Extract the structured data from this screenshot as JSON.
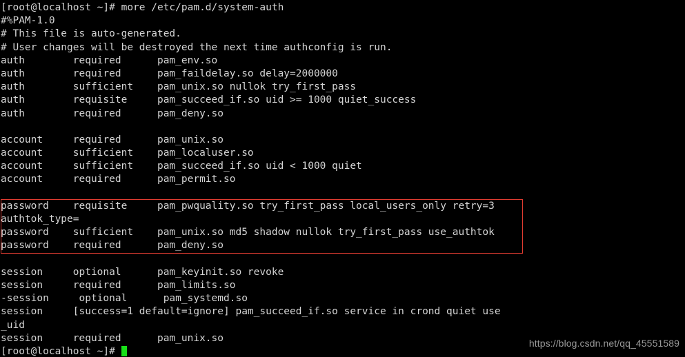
{
  "terminal": {
    "prompt": "[root@localhost ~]#",
    "command": "more /etc/pam.d/system-auth",
    "background_color": "#000000",
    "text_color": "#d4d4d4",
    "cursor_color": "#18e018",
    "highlight_color": "#e03c31",
    "lines": [
      "[root@localhost ~]# more /etc/pam.d/system-auth",
      "#%PAM-1.0",
      "# This file is auto-generated.",
      "# User changes will be destroyed the next time authconfig is run.",
      "auth        required      pam_env.so",
      "auth        required      pam_faildelay.so delay=2000000",
      "auth        sufficient    pam_unix.so nullok try_first_pass",
      "auth        requisite     pam_succeed_if.so uid >= 1000 quiet_success",
      "auth        required      pam_deny.so",
      "",
      "account     required      pam_unix.so",
      "account     sufficient    pam_localuser.so",
      "account     sufficient    pam_succeed_if.so uid < 1000 quiet",
      "account     required      pam_permit.so",
      "",
      "password    requisite     pam_pwquality.so try_first_pass local_users_only retry=3",
      "authtok_type=",
      "password    sufficient    pam_unix.so md5 shadow nullok try_first_pass use_authtok",
      "password    required      pam_deny.so",
      "",
      "session     optional      pam_keyinit.so revoke",
      "session     required      pam_limits.so",
      "-session     optional      pam_systemd.so",
      "session     [success=1 default=ignore] pam_succeed_if.so service in crond quiet use",
      "_uid",
      "session     required      pam_unix.so",
      "[root@localhost ~]# "
    ],
    "cursor_line_index": 26,
    "highlight": {
      "label": "password-section-highlight",
      "start_line_index": 15,
      "end_line_index": 18
    }
  },
  "watermark": {
    "text": "https://blog.csdn.net/qq_45551589"
  }
}
